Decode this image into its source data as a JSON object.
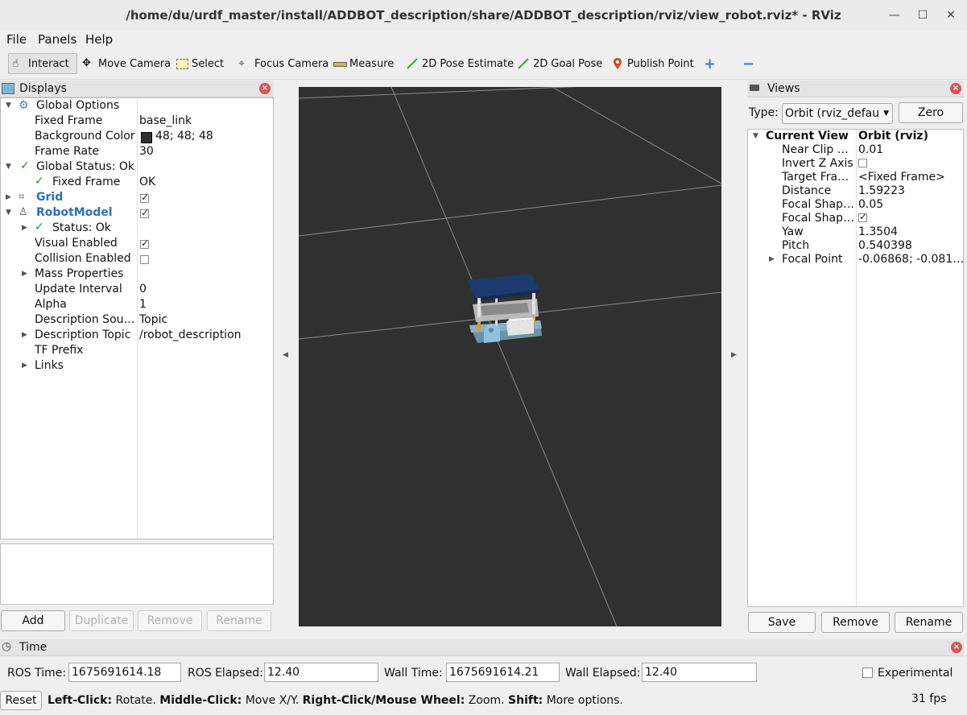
{
  "window": {
    "title": "/home/du/urdf_master/install/ADDBOT_description/share/ADDBOT_description/rviz/view_robot.rviz* - RViz",
    "minimize": "—",
    "maximize": "☐",
    "close": "✕"
  },
  "menu": {
    "file": "File",
    "panels": "Panels",
    "help": "Help"
  },
  "toolbar": {
    "interact": "Interact",
    "move_camera": "Move Camera",
    "select": "Select",
    "focus_camera": "Focus Camera",
    "measure": "Measure",
    "pose_estimate": "2D Pose Estimate",
    "goal_pose": "2D Goal Pose",
    "publish_point": "Publish Point",
    "add_tool": "+",
    "remove_tool": "−"
  },
  "displays": {
    "title": "Displays",
    "rows": {
      "global_options": "Global Options",
      "fixed_frame_k": "Fixed Frame",
      "fixed_frame_v": "base_link",
      "bg_color_k": "Background Color",
      "bg_color_v": "48; 48; 48",
      "frame_rate_k": "Frame Rate",
      "frame_rate_v": "30",
      "global_status": "Global Status: Ok",
      "gs_fixed_frame_k": "Fixed Frame",
      "gs_fixed_frame_v": "OK",
      "grid": "Grid",
      "robot_model": "RobotModel",
      "rm_status": "Status: Ok",
      "visual_enabled": "Visual Enabled",
      "collision_enabled": "Collision Enabled",
      "mass_properties": "Mass Properties",
      "update_interval_k": "Update Interval",
      "update_interval_v": "0",
      "alpha_k": "Alpha",
      "alpha_v": "1",
      "desc_source_k": "Description Sou…",
      "desc_source_v": "Topic",
      "desc_topic_k": "Description Topic",
      "desc_topic_v": "/robot_description",
      "tf_prefix": "TF Prefix",
      "links": "Links"
    },
    "buttons": {
      "add": "Add",
      "duplicate": "Duplicate",
      "remove": "Remove",
      "rename": "Rename"
    }
  },
  "views": {
    "title": "Views",
    "type_label": "Type:",
    "type_value": "Orbit (rviz_defau",
    "zero": "Zero",
    "rows": {
      "current_view_k": "Current View",
      "current_view_v": "Orbit (rviz)",
      "near_clip_k": "Near Clip …",
      "near_clip_v": "0.01",
      "invert_z_k": "Invert Z Axis",
      "target_frame_k": "Target Fra…",
      "target_frame_v": "<Fixed Frame>",
      "distance_k": "Distance",
      "distance_v": "1.59223",
      "focal_shape1_k": "Focal Shap…",
      "focal_shape1_v": "0.05",
      "focal_shape2_k": "Focal Shap…",
      "yaw_k": "Yaw",
      "yaw_v": "1.3504",
      "pitch_k": "Pitch",
      "pitch_v": "0.540398",
      "focal_point_k": "Focal Point",
      "focal_point_v": "-0.06868; -0.081…"
    },
    "buttons": {
      "save": "Save",
      "remove": "Remove",
      "rename": "Rename"
    }
  },
  "time": {
    "title": "Time",
    "ros_time_label": "ROS Time:",
    "ros_time": "1675691614.18",
    "ros_elapsed_label": "ROS Elapsed:",
    "ros_elapsed": "12.40",
    "wall_time_label": "Wall Time:",
    "wall_time": "1675691614.21",
    "wall_elapsed_label": "Wall Elapsed:",
    "wall_elapsed": "12.40",
    "experimental": "Experimental"
  },
  "status": {
    "reset": "Reset",
    "left_click_b": "Left-Click:",
    "left_click": " Rotate. ",
    "middle_click_b": "Middle-Click:",
    "middle_click": " Move X/Y. ",
    "right_click_b": "Right-Click/Mouse Wheel:",
    "right_click": " Zoom. ",
    "shift_b": "Shift:",
    "shift": " More options.",
    "fps": "31 fps"
  },
  "colors": {
    "viewport_bg": "#303030",
    "link_blue": "#2a6fbf",
    "status_ok": "#2a8a2a"
  }
}
